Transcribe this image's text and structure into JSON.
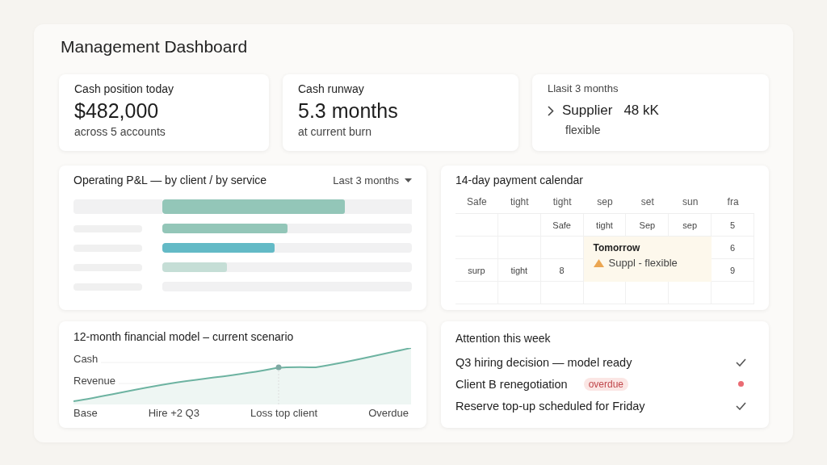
{
  "title": "Management Dashboard",
  "kpis": [
    {
      "label": "Cash position today",
      "value": "$482,000",
      "note": "across 5 accounts"
    },
    {
      "label": "Cash runway",
      "value": "5.3 months",
      "note": "at current burn"
    }
  ],
  "supplier_card": {
    "label": "Llasit 3 months",
    "name": "Supplier",
    "amount": "48 kK",
    "note": "flexible"
  },
  "pnl": {
    "title": "Operating P&L — by client / by service",
    "period": "Last 3 months",
    "rows": [
      {
        "kind": "total",
        "level": 0.73,
        "color": "#93c6b8"
      },
      {
        "kind": "item",
        "level": 0.5,
        "color": "#93c6b8"
      },
      {
        "kind": "item",
        "level": 0.45,
        "color": "#63bac6"
      },
      {
        "kind": "item",
        "level": 0.26,
        "color": "#c5ded6"
      },
      {
        "kind": "item"
      }
    ]
  },
  "calendar": {
    "title": "14-day payment calendar",
    "columns": [
      "Safe",
      "tight",
      "tight",
      "sep",
      "set",
      "sun",
      "fra"
    ],
    "rows": [
      [
        null,
        null,
        "Safe",
        "tight",
        "Sep",
        "sep",
        "5"
      ],
      [
        null,
        null,
        null,
        null,
        null,
        null,
        "6"
      ],
      [
        "surp",
        "tight",
        "8",
        null,
        null,
        null,
        "9"
      ],
      [
        null,
        null,
        null,
        null,
        null,
        null,
        null
      ]
    ],
    "popover": {
      "title": "Tomorrow",
      "text": "Suppl - flexible"
    }
  },
  "model": {
    "title": "12-month financial model – current scenario",
    "series_labels": [
      "Cash",
      "Revenue"
    ],
    "x_labels": [
      "Base",
      "Hire +2 Q3",
      "Loss top client",
      "Overdue"
    ]
  },
  "attention": {
    "title": "Attention this week",
    "items": [
      {
        "text": "Q3 hiring decision — model ready",
        "kind": "check"
      },
      {
        "text": "Client B renegotiation",
        "badge": "overdue",
        "kind": "dot"
      },
      {
        "text": "Reserve top-up scheduled for Friday",
        "kind": "check"
      }
    ]
  }
}
